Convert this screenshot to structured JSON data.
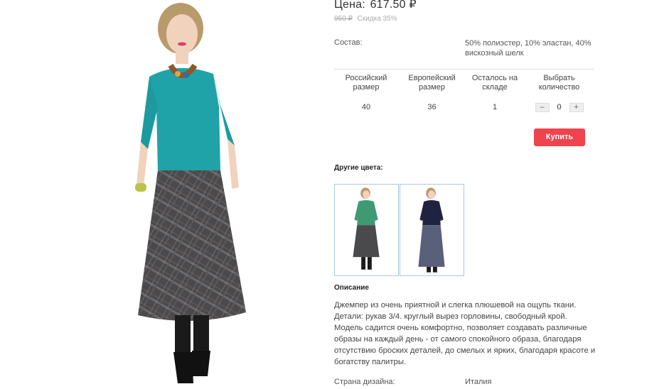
{
  "price": {
    "label": "Цена:",
    "value": "617.50",
    "currency": "₽"
  },
  "old_price": {
    "value": "950 ₽",
    "discount": "Скидка 35%"
  },
  "composition": {
    "label": "Состав:",
    "value": "50% полиэстер, 10% эластан, 40% вискозный шелк"
  },
  "size_table": {
    "headers": [
      "Российский размер",
      "Европейский размер",
      "Осталось на складе",
      "Выбрать количество"
    ],
    "row": {
      "ru_size": "40",
      "eu_size": "36",
      "stock": "1",
      "quantity": "0"
    },
    "minus": "–",
    "plus": "+"
  },
  "buy_label": "Купить",
  "other_colors": {
    "title": "Другие цвета:",
    "items": [
      {
        "icon": "green-sweater-thumbnail",
        "color": "#3f9a73"
      },
      {
        "icon": "navy-sweater-thumbnail",
        "color": "#1f2240"
      }
    ]
  },
  "description": {
    "title": "Описание",
    "text": "Джемпер из очень приятной и слегка плюшевой на ощупь ткани. Детали: рукав 3/4. круглый вырез горловины, свободный крой. Модель садится очень комфортно, позволяет создавать различные образы на каждый день - от самого спокойного образа, благодаря отсутствию броских деталей, до смелых и ярких, благодаря красоте и богатству палитры."
  },
  "country": {
    "label": "Страна дизайна:",
    "value": "Италия"
  },
  "colors": {
    "accent": "#f0434e",
    "main_sweater": "#1fa3a8",
    "skirt": "#4a4a4c"
  }
}
